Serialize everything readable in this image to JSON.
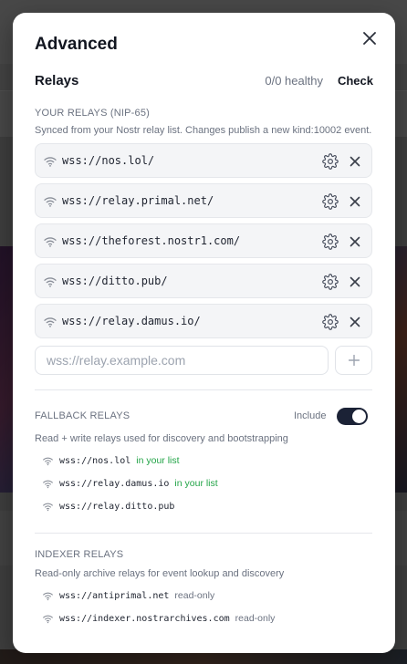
{
  "modal": {
    "title": "Advanced",
    "relays_label": "Relays",
    "health": "0/0 healthy",
    "check_label": "Check"
  },
  "your_relays": {
    "heading": "YOUR RELAYS (NIP-65)",
    "description": "Synced from your Nostr relay list. Changes publish a new kind:10002 event.",
    "items": [
      {
        "url": "wss://nos.lol/"
      },
      {
        "url": "wss://relay.primal.net/"
      },
      {
        "url": "wss://theforest.nostr1.com/"
      },
      {
        "url": "wss://ditto.pub/"
      },
      {
        "url": "wss://relay.damus.io/"
      }
    ],
    "input_placeholder": "wss://relay.example.com",
    "input_value": ""
  },
  "fallback": {
    "heading": "FALLBACK RELAYS",
    "include_label": "Include",
    "include_on": true,
    "description": "Read + write relays used for discovery and bootstrapping",
    "items": [
      {
        "url": "wss://nos.lol",
        "tag": "in your list"
      },
      {
        "url": "wss://relay.damus.io",
        "tag": "in your list"
      },
      {
        "url": "wss://relay.ditto.pub",
        "tag": ""
      }
    ]
  },
  "indexer": {
    "heading": "INDEXER RELAYS",
    "description": "Read-only archive relays for event lookup and discovery",
    "items": [
      {
        "url": "wss://antiprimal.net",
        "tag": "read-only"
      },
      {
        "url": "wss://indexer.nostrarchives.com",
        "tag": "read-only"
      }
    ]
  },
  "colors": {
    "accent_dark": "#1b2236",
    "tag_green": "#22a447",
    "muted": "#6b7280"
  },
  "icons": {
    "close": "close-icon",
    "signal": "wifi-icon",
    "settings": "gear-icon",
    "remove": "close-icon",
    "add": "plus-icon"
  }
}
